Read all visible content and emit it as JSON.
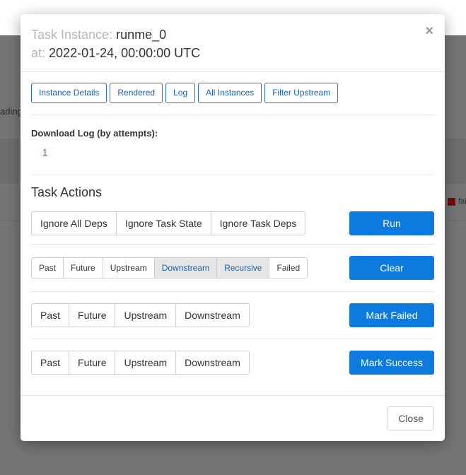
{
  "background": {
    "partial_text": "ading",
    "legend_text": "fai"
  },
  "modal": {
    "title_key_task": "Task Instance:",
    "title_task": "runme_0",
    "title_key_at": "at:",
    "title_at": "2022-01-24, 00:00:00 UTC",
    "close_glyph": "×"
  },
  "top_buttons": [
    "Instance Details",
    "Rendered",
    "Log",
    "All Instances",
    "Filter Upstream"
  ],
  "download": {
    "label": "Download Log (by attempts):",
    "attempts": [
      "1"
    ]
  },
  "task_actions": {
    "title": "Task Actions",
    "run": {
      "options": [
        "Ignore All Deps",
        "Ignore Task State",
        "Ignore Task Deps"
      ],
      "button": "Run"
    },
    "clear": {
      "options": [
        "Past",
        "Future",
        "Upstream",
        "Downstream",
        "Recursive",
        "Failed"
      ],
      "active": [
        "Downstream",
        "Recursive"
      ],
      "button": "Clear"
    },
    "mark_failed": {
      "options": [
        "Past",
        "Future",
        "Upstream",
        "Downstream"
      ],
      "button": "Mark Failed"
    },
    "mark_success": {
      "options": [
        "Past",
        "Future",
        "Upstream",
        "Downstream"
      ],
      "button": "Mark Success"
    }
  },
  "footer": {
    "close_label": "Close"
  },
  "colors": {
    "primary": "#0d7ae0",
    "legend_failed": "#8b0000"
  }
}
